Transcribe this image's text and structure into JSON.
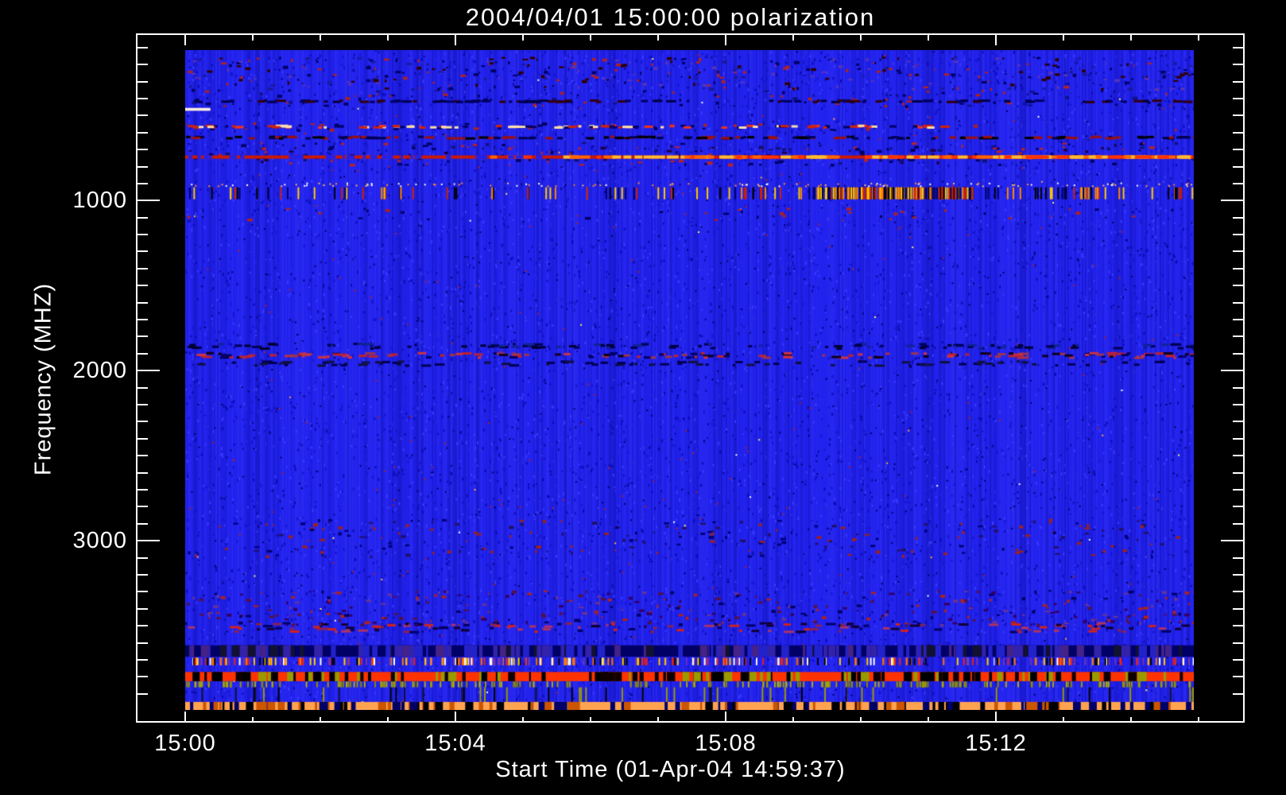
{
  "page": {
    "background": "#000000",
    "axis_color": "#ffffff"
  },
  "chart_data": {
    "type": "heatmap",
    "subtype": "radio-spectrogram",
    "title": "2004/04/01 15:00:00 polarization",
    "xlabel": "Start Time (01-Apr-04 14:59:37)",
    "ylabel": "Frequency (MHZ)",
    "x_axis": {
      "start_label": "15:00",
      "minutes_shown": 14.93,
      "major_ticks": [
        {
          "label": "15:00",
          "minutes": 0
        },
        {
          "label": "15:04",
          "minutes": 4
        },
        {
          "label": "15:08",
          "minutes": 8
        },
        {
          "label": "15:12",
          "minutes": 12
        }
      ],
      "minor_tick_minutes": [
        1,
        2,
        3,
        5,
        6,
        7,
        9,
        10,
        11,
        13,
        14,
        15
      ]
    },
    "y_axis": {
      "units": "MHz",
      "range": [
        115,
        3995
      ],
      "direction": "increasing-downward",
      "major_ticks": [
        {
          "label": "1000",
          "mhz": 1000
        },
        {
          "label": "2000",
          "mhz": 2000
        },
        {
          "label": "3000",
          "mhz": 3000
        }
      ],
      "minor_step_mhz": 100
    },
    "colormap": {
      "background_blue": "#2121ee",
      "dark_navy": "#000066",
      "red": "#cc2222",
      "orange_red_band": "#ff3300",
      "sandy_orange_band": "#ffa351",
      "olive": "#999900",
      "yellow": "#ffcc00",
      "white": "#ffffff",
      "purple": "#663399"
    },
    "bands": [
      {
        "f0": 150,
        "f1": 340,
        "kind": "noise",
        "density": 0.55,
        "colors": [
          "#000066",
          "#1a1a99",
          "#b22222",
          "#300000",
          "#5533bb"
        ]
      },
      {
        "f0": 340,
        "f1": 440,
        "kind": "noise",
        "density": 0.3,
        "colors": [
          "#000066",
          "#aa2222",
          "#111188"
        ]
      },
      {
        "f0": 405,
        "f1": 428,
        "kind": "dashrow",
        "density": 0.5,
        "colors": [
          "#000044",
          "#000066",
          "#330011"
        ]
      },
      {
        "f0": 540,
        "f1": 580,
        "kind": "noise",
        "density": 0.35,
        "colors": [
          "#000066",
          "#aa2222"
        ]
      },
      {
        "f0": 552,
        "f1": 578,
        "kind": "dashrow",
        "density": 0.55,
        "colors": [
          "#cc2211",
          "#ee3322",
          "#000066",
          "#ffddaa"
        ],
        "t0": 0,
        "t1": 0.75
      },
      {
        "f0": 618,
        "f1": 642,
        "kind": "dashrow",
        "density": 0.6,
        "colors": [
          "#000000",
          "#000055",
          "#991111"
        ]
      },
      {
        "f0": 655,
        "f1": 785,
        "kind": "noise",
        "density": 0.5,
        "colors": [
          "#000066",
          "#bb2222",
          "#111177",
          "#220044"
        ]
      },
      {
        "f0": 732,
        "f1": 756,
        "kind": "line",
        "color": "#cc1a00",
        "bright": [
          "#ff3300",
          "#ff6600",
          "#ffbb33"
        ]
      },
      {
        "f0": 893,
        "f1": 912,
        "kind": "dots",
        "density": 0.2,
        "colors": [
          "#ffffff",
          "#ffbb66",
          "#ff8833"
        ]
      },
      {
        "f0": 922,
        "f1": 992,
        "kind": "vdash",
        "density": 0.3,
        "colors": [
          "#000000",
          "#ffcc00",
          "#cc2200",
          "#ff8800",
          "#000066"
        ],
        "dense_t0": 0.62,
        "dense_t1": 0.78
      },
      {
        "f0": 1040,
        "f1": 1110,
        "kind": "noise",
        "density": 0.18,
        "colors": [
          "#aa2222",
          "#000066"
        ]
      },
      {
        "f0": 1835,
        "f1": 1878,
        "kind": "dashrow",
        "density": 0.45,
        "colors": [
          "#000055",
          "#000033",
          "#112299"
        ]
      },
      {
        "f0": 1890,
        "f1": 1932,
        "kind": "dashrow",
        "density": 0.6,
        "colors": [
          "#993355",
          "#bb2233",
          "#10001a",
          "#000066",
          "#cc3344"
        ]
      },
      {
        "f0": 1938,
        "f1": 1978,
        "kind": "dashrow",
        "density": 0.35,
        "colors": [
          "#000055",
          "#111144"
        ]
      },
      {
        "f0": 2870,
        "f1": 3090,
        "kind": "noise",
        "density": 0.3,
        "colors": [
          "#000077",
          "#992222",
          "#221166"
        ]
      },
      {
        "f0": 3290,
        "f1": 3490,
        "kind": "noise",
        "density": 0.5,
        "colors": [
          "#330066",
          "#663399",
          "#000066",
          "#aa2222",
          "#551144"
        ]
      },
      {
        "f0": 3478,
        "f1": 3545,
        "kind": "dashrow",
        "density": 0.55,
        "colors": [
          "#882255",
          "#aa3366",
          "#cc2222",
          "#110033",
          "#000066"
        ]
      },
      {
        "f0": 3615,
        "f1": 3682,
        "kind": "band",
        "bg": "#000066",
        "gapdensity": 0.55,
        "gapcolors": [
          "#3322aa",
          "#442288",
          "#111133",
          "#2222cc"
        ]
      },
      {
        "f0": 3688,
        "f1": 3732,
        "kind": "vdash",
        "density": 0.85,
        "colors": [
          "#ee2211",
          "#ffcc00",
          "#ffffff",
          "#7733aa",
          "#000000",
          "#ff7700",
          "#2222ff"
        ]
      },
      {
        "f0": 3772,
        "f1": 3826,
        "kind": "band",
        "bg": "#ff3300",
        "gapdensity": 0.4,
        "gapcolors": [
          "#000000",
          "#999900",
          "#110000"
        ]
      },
      {
        "f0": 3828,
        "f1": 3862,
        "kind": "vdash",
        "density": 0.5,
        "colors": [
          "#999900",
          "#888800",
          "#aaaa11"
        ]
      },
      {
        "f0": 3862,
        "f1": 3948,
        "kind": "vdash",
        "density": 0.12,
        "colors": [
          "#999900",
          "#000000",
          "#111133"
        ]
      },
      {
        "f0": 3948,
        "f1": 3995,
        "kind": "band",
        "bg": "#ffa351",
        "gapdensity": 0.45,
        "gapcolors": [
          "#000066",
          "#000000",
          "#cc5500"
        ]
      }
    ],
    "features": [
      {
        "kind": "segment",
        "f0": 455,
        "f1": 472,
        "t0": 0.0,
        "t1": 0.025,
        "color": "#ffeedd",
        "note": "bright white dash near 15:00 at ~460 MHz"
      }
    ]
  }
}
